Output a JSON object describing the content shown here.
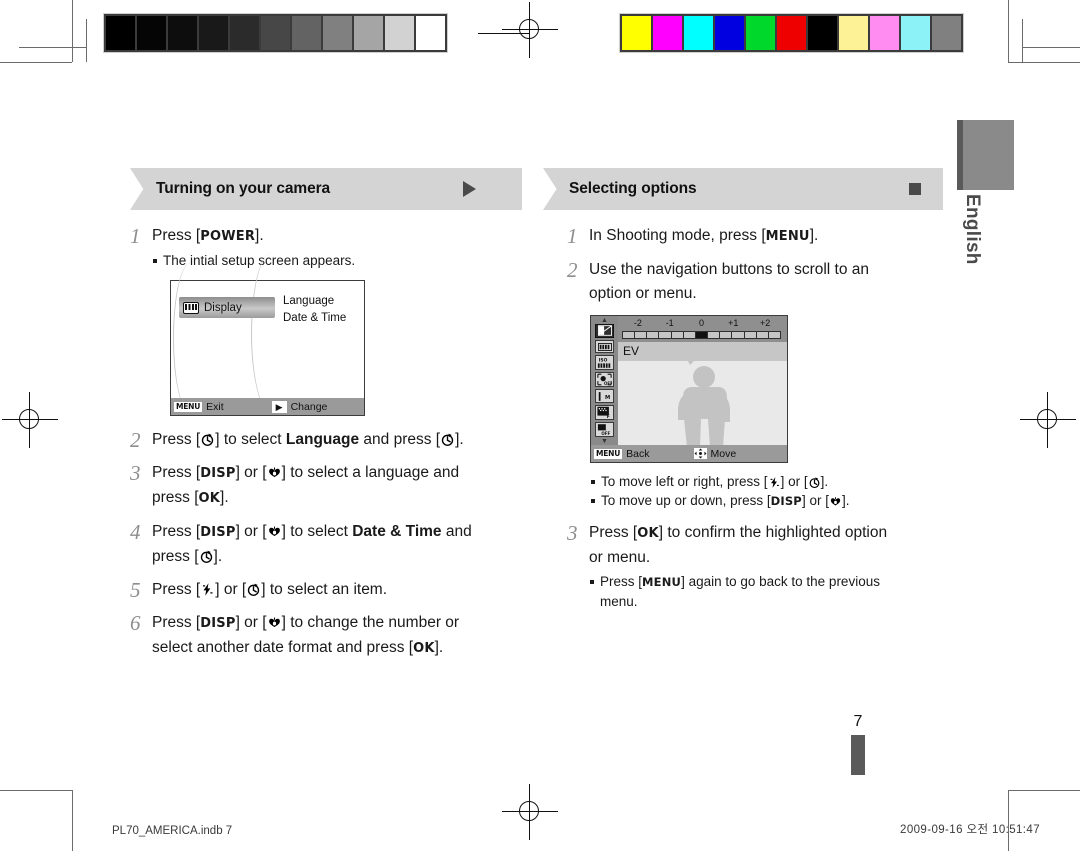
{
  "page": {
    "number": "7",
    "language_tab": "English"
  },
  "calibration": {
    "gray_strip_label": "grayscale-calibration-strip",
    "gray_values": [
      "#000000",
      "#050505",
      "#0d0d0d",
      "#191919",
      "#2b2b2b",
      "#474747",
      "#636363",
      "#808080",
      "#a5a5a5",
      "#d2d2d2",
      "#ffffff"
    ],
    "color_strip_label": "color-calibration-strip",
    "color_values": [
      "#ffff00",
      "#ff00ff",
      "#00ffff",
      "#0000e0",
      "#00d92b",
      "#ee0000",
      "#000000",
      "#fdf396",
      "#ff8cf0",
      "#8cf2f7",
      "#808080"
    ]
  },
  "left_section": {
    "title": "Turning on your camera",
    "marker_icon": "triangle-right-icon",
    "steps": [
      {
        "num": "1",
        "lines": [
          "Press [POWER]."
        ],
        "notes": [
          "The intial setup screen appears."
        ]
      },
      {
        "num": "2",
        "lines": [
          "Press [<timer>] to select Language and press [<timer>]."
        ],
        "notes": []
      },
      {
        "num": "3",
        "lines": [
          "Press [DISP] or [<macro>] to select a language and",
          "press [OK]."
        ],
        "notes": []
      },
      {
        "num": "4",
        "lines": [
          "Press [DISP] or [<macro>] to select Date & Time and",
          "press [<timer>]."
        ],
        "notes": []
      },
      {
        "num": "5",
        "lines": [
          "Press [<flash>] or [<timer>] to select an item."
        ],
        "notes": []
      },
      {
        "num": "6",
        "lines": [
          "Press [DISP] or [<macro>] to change the number or",
          "select another date format and press [OK]."
        ],
        "notes": []
      }
    ],
    "lcd": {
      "highlighted_item": "Display",
      "highlight_icon": "display-icon",
      "menu_items": [
        "Language",
        "Date & Time"
      ],
      "bottom_left_chip": "MENU",
      "bottom_left_label": "Exit",
      "bottom_right_chip": "▶",
      "bottom_right_label": "Change"
    }
  },
  "right_section": {
    "title": "Selecting options",
    "marker_icon": "square-icon",
    "steps": [
      {
        "num": "1",
        "lines": [
          "In Shooting mode, press [MENU]."
        ],
        "notes": []
      },
      {
        "num": "2",
        "lines": [
          "Use the navigation buttons to scroll to an",
          "option or menu."
        ],
        "notes": [
          "To move left or right, press [<flash>] or [<timer>].",
          "To move up or down, press [DISP] or [<macro>]."
        ]
      },
      {
        "num": "3",
        "lines": [
          "Press [OK] to confirm the highlighted option",
          "or menu."
        ],
        "notes": [
          "Press [MENU] again to go back to the previous menu."
        ]
      }
    ],
    "lcd": {
      "ev_scale_labels": [
        "-2",
        "-1",
        "0",
        "+1",
        "+2"
      ],
      "ev_indicator_position": "0",
      "setting_label": "EV",
      "sidebar_icons": [
        "ev-icon",
        "resolution-icon",
        "iso-icon",
        "face-detect-off-icon",
        "focus-area-icon",
        "white-balance-icon",
        "flash-off-icon"
      ],
      "bottom_left_chip": "MENU",
      "bottom_left_label": "Back",
      "bottom_right_chip": "dpad-icon",
      "bottom_right_label": "Move"
    }
  },
  "footer": {
    "file": "PL70_AMERICA.indb   7",
    "timestamp": "2009-09-16   오전 10:51:47"
  }
}
